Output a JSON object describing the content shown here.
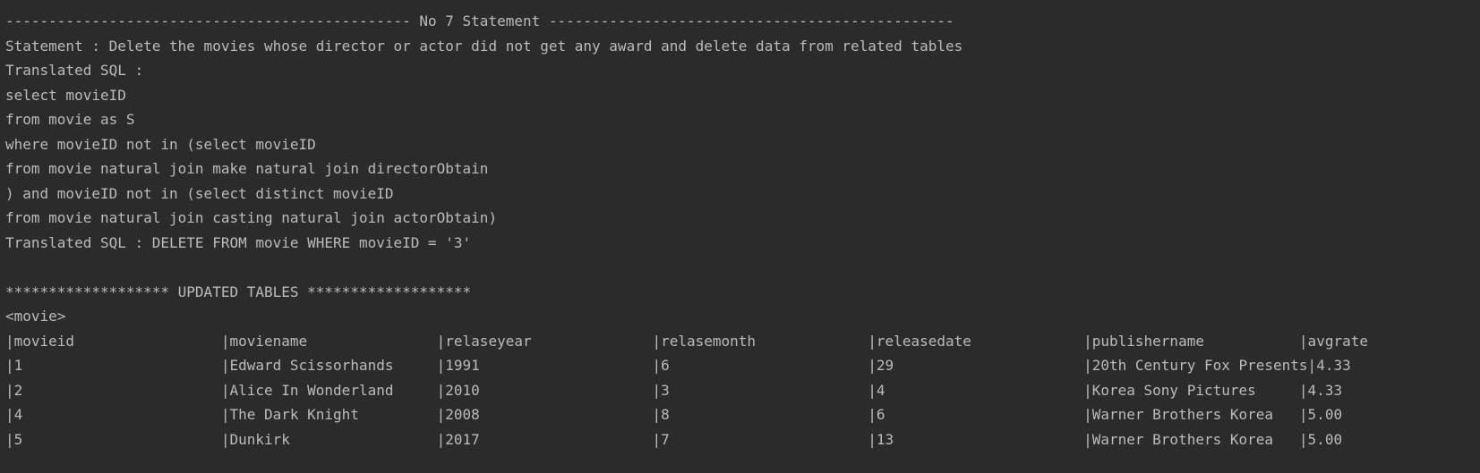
{
  "console": {
    "lines": [
      "----------------------------------------------- No 7 Statement -----------------------------------------------",
      "Statement : Delete the movies whose director or actor did not get any award and delete data from related tables",
      "Translated SQL :",
      "select movieID",
      "from movie as S",
      "where movieID not in (select movieID",
      "from movie natural join make natural join directorObtain",
      ") and movieID not in (select distinct movieID",
      "from movie natural join casting natural join actorObtain)",
      "Translated SQL : DELETE FROM movie WHERE movieID = '3'",
      "",
      "******************* UPDATED TABLES *******************",
      "<movie>",
      "|movieid                 |moviename               |relaseyear              |relasemonth             |releasedate             |publishername           |avgrate",
      "|1                       |Edward Scissorhands     |1991                    |6                       |29                      |20th Century Fox Presents|4.33",
      "|2                       |Alice In Wonderland     |2010                    |3                       |4                       |Korea Sony Pictures     |4.33",
      "|4                       |The Dark Knight         |2008                    |8                       |6                       |Warner Brothers Korea   |5.00",
      "|5                       |Dunkirk                 |2017                    |7                       |13                      |Warner Brothers Korea   |5.00"
    ]
  }
}
